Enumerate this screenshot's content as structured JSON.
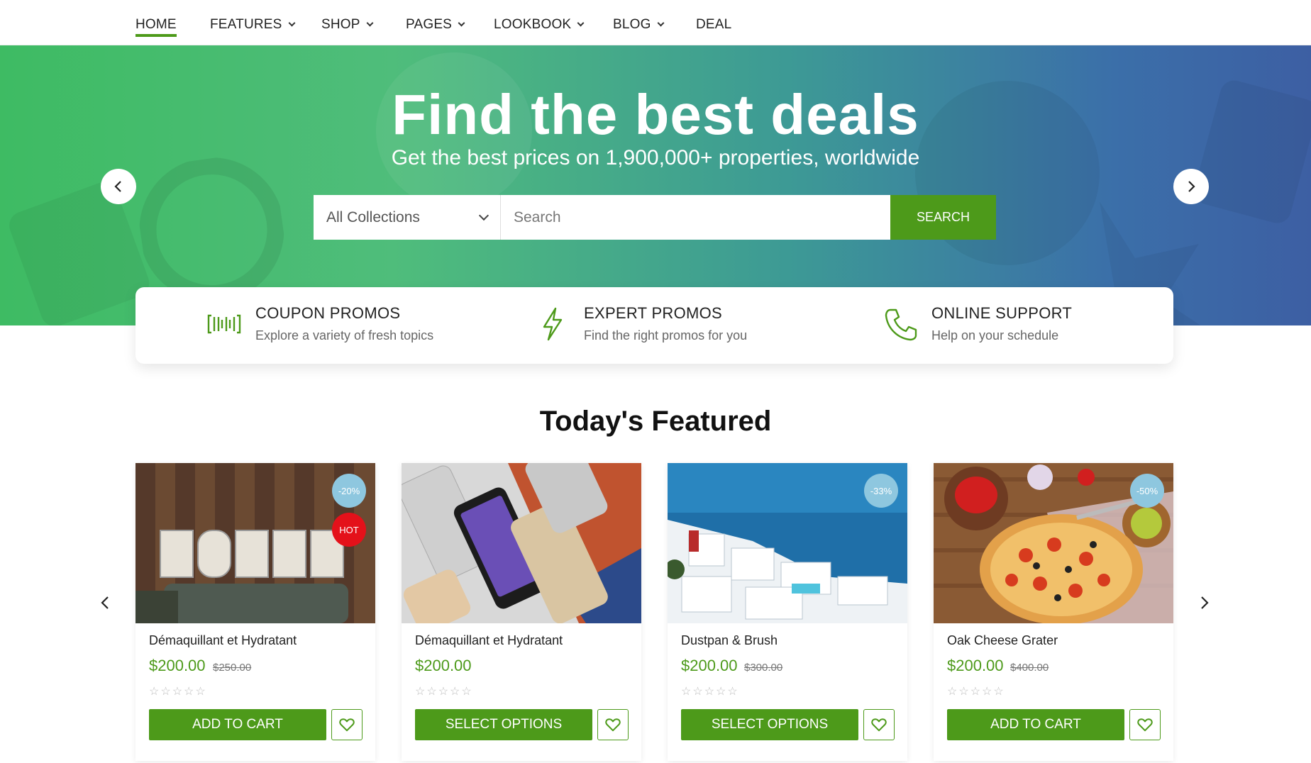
{
  "nav": {
    "items": [
      {
        "label": "HOME",
        "dropdown": false,
        "active": true
      },
      {
        "label": "FEATURES",
        "dropdown": true,
        "active": false
      },
      {
        "label": "SHOP",
        "dropdown": true,
        "active": false
      },
      {
        "label": "PAGES",
        "dropdown": true,
        "active": false
      },
      {
        "label": "LOOKBOOK",
        "dropdown": true,
        "active": false
      },
      {
        "label": "BLOG",
        "dropdown": true,
        "active": false
      },
      {
        "label": "DEAL",
        "dropdown": false,
        "active": false
      }
    ]
  },
  "hero": {
    "title": "Find the best deals",
    "subtitle": "Get the best prices on 1,900,000+ properties, worldwide",
    "collection_value": "All Collections",
    "search_placeholder": "Search",
    "search_button": "SEARCH"
  },
  "features": [
    {
      "icon": "barcode-icon",
      "title": "COUPON PROMOS",
      "desc": "Explore a variety of fresh topics"
    },
    {
      "icon": "lightning-icon",
      "title": "EXPERT PROMOS",
      "desc": "Find the right promos for you"
    },
    {
      "icon": "phone-icon",
      "title": "ONLINE SUPPORT",
      "desc": "Help on your schedule"
    }
  ],
  "featured": {
    "title": "Today's Featured",
    "products": [
      {
        "name": "Démaquillant et Hydratant",
        "price": "$200.00",
        "old_price": "$250.00",
        "discount": "-20%",
        "hot": "HOT",
        "button": "ADD TO CART",
        "image": "hotel-sign"
      },
      {
        "name": "Démaquillant et Hydratant",
        "price": "$200.00",
        "old_price": "",
        "discount": "",
        "hot": "",
        "button": "SELECT OPTIONS",
        "image": "smartphones"
      },
      {
        "name": "Dustpan & Brush",
        "price": "$200.00",
        "old_price": "$300.00",
        "discount": "-33%",
        "hot": "",
        "button": "SELECT OPTIONS",
        "image": "santorini-coast"
      },
      {
        "name": "Oak Cheese Grater",
        "price": "$200.00",
        "old_price": "$400.00",
        "discount": "-50%",
        "hot": "",
        "button": "ADD TO CART",
        "image": "pizza"
      }
    ]
  },
  "colors": {
    "accent": "#4d9a1a",
    "badge_discount": "#8ec7df",
    "badge_hot": "#e4111a"
  }
}
